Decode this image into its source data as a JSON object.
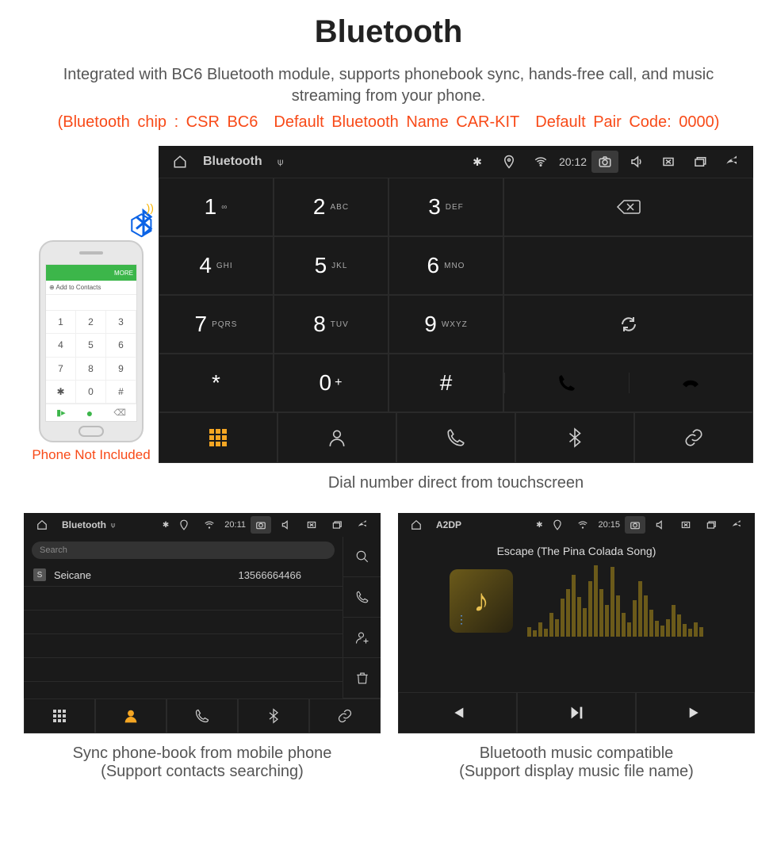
{
  "header": {
    "title": "Bluetooth",
    "description": "Integrated with BC6 Bluetooth module, supports phonebook sync, hands-free call, and music streaming from your phone.",
    "specs": "(Bluetooth chip : CSR BC6 Default Bluetooth Name CAR-KIT Default Pair Code: 0000)"
  },
  "phone": {
    "caption": "Phone Not Included",
    "bar_more": "MORE",
    "bar_add": "⊕ Add to Contacts",
    "keys": [
      "1",
      "2",
      "3",
      "4",
      "5",
      "6",
      "7",
      "8",
      "9",
      "✱",
      "0",
      "#"
    ]
  },
  "dialer": {
    "status_title": "Bluetooth",
    "time": "20:12",
    "keys": [
      {
        "d": "1",
        "s": "∞"
      },
      {
        "d": "2",
        "s": "ABC"
      },
      {
        "d": "3",
        "s": "DEF"
      },
      {
        "d": "4",
        "s": "GHI"
      },
      {
        "d": "5",
        "s": "JKL"
      },
      {
        "d": "6",
        "s": "MNO"
      },
      {
        "d": "7",
        "s": "PQRS"
      },
      {
        "d": "8",
        "s": "TUV"
      },
      {
        "d": "9",
        "s": "WXYZ"
      },
      {
        "d": "*",
        "s": ""
      },
      {
        "d": "0",
        "s": "+",
        "sup": true
      },
      {
        "d": "#",
        "s": ""
      }
    ],
    "caption": "Dial number direct from touchscreen"
  },
  "phonebook": {
    "status_title": "Bluetooth",
    "time": "20:11",
    "search_placeholder": "Search",
    "contact_tag": "S",
    "contact_name": "Seicane",
    "contact_number": "13566664466",
    "caption_line1": "Sync phone-book from mobile phone",
    "caption_line2": "(Support contacts searching)"
  },
  "music": {
    "status_title": "A2DP",
    "time": "20:15",
    "song": "Escape (The Pina Colada Song)",
    "caption_line1": "Bluetooth music compatible",
    "caption_line2": "(Support display music file name)",
    "bars": [
      12,
      8,
      18,
      10,
      30,
      22,
      48,
      60,
      78,
      50,
      36,
      70,
      90,
      60,
      40,
      88,
      52,
      30,
      18,
      46,
      70,
      52,
      34,
      20,
      14,
      22,
      40,
      28,
      16,
      10,
      18,
      12
    ]
  }
}
